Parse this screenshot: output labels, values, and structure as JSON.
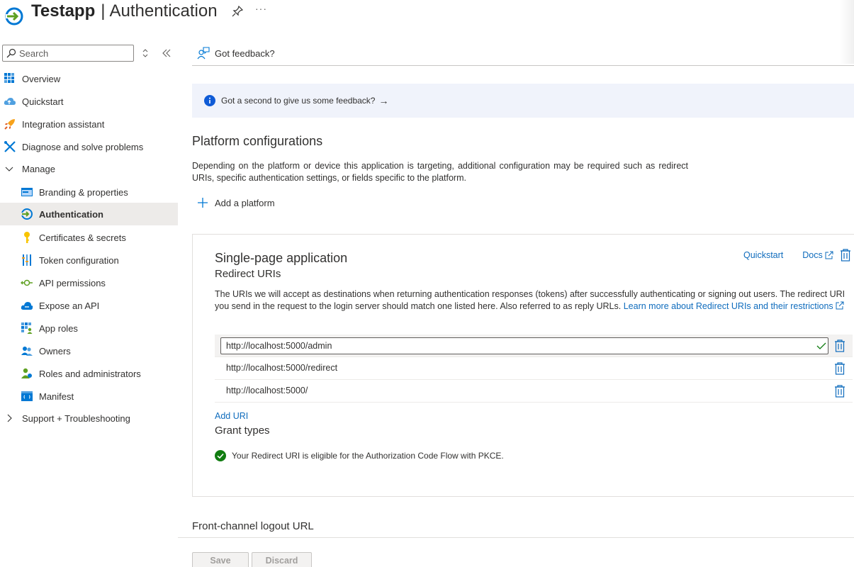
{
  "header": {
    "app_name": "Testapp",
    "separator": "|",
    "page_title": "Authentication",
    "more_label": "···"
  },
  "sidebar": {
    "search_placeholder": "Search",
    "items": [
      {
        "label": "Overview"
      },
      {
        "label": "Quickstart"
      },
      {
        "label": "Integration assistant"
      },
      {
        "label": "Diagnose and solve problems"
      },
      {
        "label": "Manage"
      },
      {
        "label": "Branding & properties"
      },
      {
        "label": "Authentication"
      },
      {
        "label": "Certificates & secrets"
      },
      {
        "label": "Token configuration"
      },
      {
        "label": "API permissions"
      },
      {
        "label": "Expose an API"
      },
      {
        "label": "App roles"
      },
      {
        "label": "Owners"
      },
      {
        "label": "Roles and administrators"
      },
      {
        "label": "Manifest"
      },
      {
        "label": "Support + Troubleshooting"
      }
    ]
  },
  "toolbar": {
    "feedback_label": "Got feedback?"
  },
  "banner": {
    "text": "Got a second to give us some feedback?",
    "arrow": "→"
  },
  "platform": {
    "title": "Platform configurations",
    "description": "Depending on the platform or device this application is targeting, additional configuration may be required such as redirect URIs, specific authentication settings, or fields specific to the platform.",
    "add_label": "Add a platform"
  },
  "spa": {
    "title": "Single-page application",
    "subtitle": "Redirect URIs",
    "quickstart_link": "Quickstart",
    "docs_link": "Docs",
    "description": "The URIs we will accept as destinations when returning authentication responses (tokens) after successfully authenticating or signing out users. The redirect URI you send in the request to the login server should match one listed here. Also referred to as reply URLs.",
    "learn_more_link": "Learn more about Redirect URIs and their restrictions",
    "uris": [
      "http://localhost:5000/admin",
      "http://localhost:5000/redirect",
      "http://localhost:5000/"
    ],
    "add_uri_label": "Add URI",
    "grant_title": "Grant types",
    "grant_message": "Your Redirect URI is eligible for the Authorization Code Flow with PKCE."
  },
  "front_channel": {
    "title": "Front-channel logout URL"
  },
  "actions": {
    "save_label": "Save",
    "discard_label": "Discard"
  },
  "colors": {
    "accent": "#0f6cbd",
    "success": "#107c10",
    "banner_bg": "#f0f3fb",
    "selected_bg": "#edebe9"
  }
}
